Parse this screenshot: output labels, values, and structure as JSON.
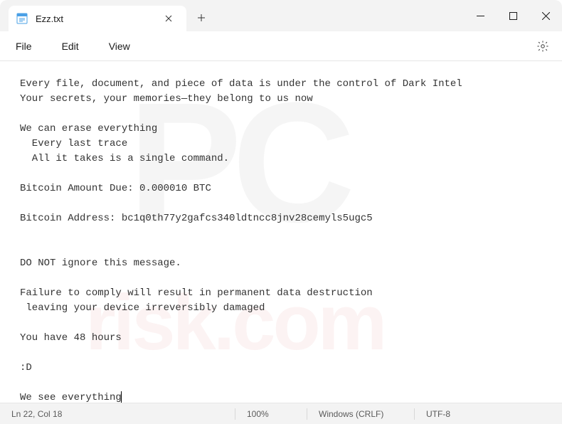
{
  "tab": {
    "title": "Ezz.txt"
  },
  "menubar": {
    "file": "File",
    "edit": "Edit",
    "view": "View"
  },
  "content": {
    "text": "Every file, document, and piece of data is under the control of Dark Intel\nYour secrets, your memories—they belong to us now\n\nWe can erase everything\n  Every last trace\n  All it takes is a single command.\n\nBitcoin Amount Due: 0.000010 BTC\n\nBitcoin Address: bc1q0th77y2gafcs340ldtncc8jnv28cemyls5ugc5\n\n\nDO NOT ignore this message.\n\nFailure to comply will result in permanent data destruction\n leaving your device irreversibly damaged\n\nYou have 48 hours\n\n:D\n\nWe see everything"
  },
  "statusbar": {
    "position": "Ln 22, Col 18",
    "zoom": "100%",
    "eol": "Windows (CRLF)",
    "encoding": "UTF-8"
  },
  "watermark": {
    "logo": "PC",
    "domain": "risk.com"
  }
}
